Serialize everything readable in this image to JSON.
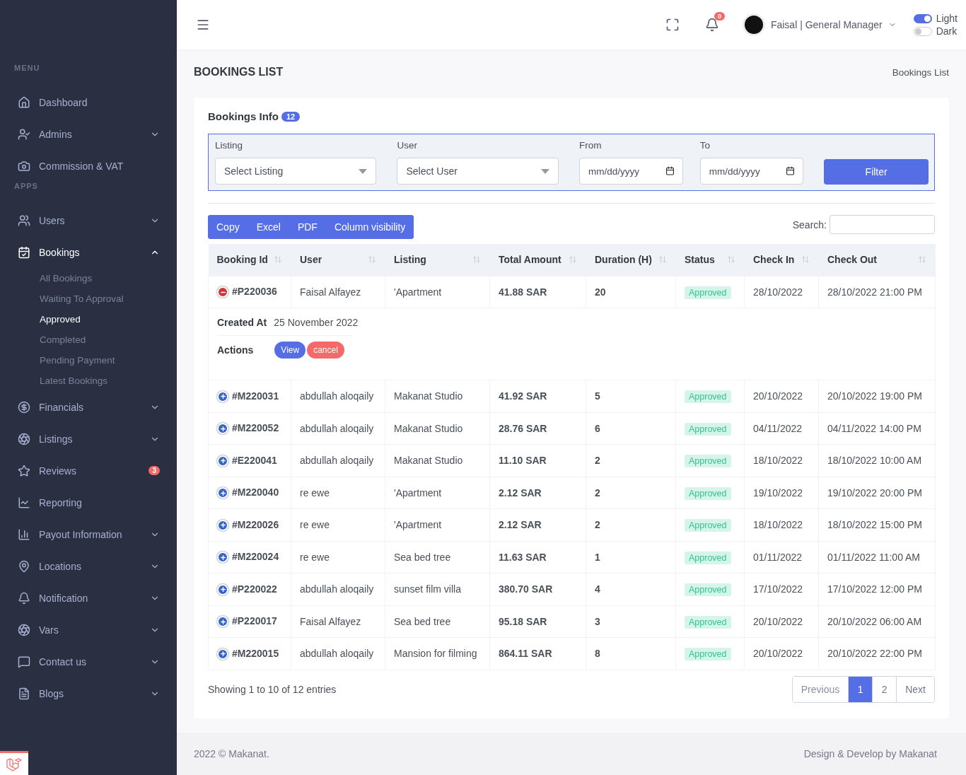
{
  "sidebar": {
    "sections": [
      {
        "title": "MENU",
        "items": [
          {
            "label": "Dashboard",
            "selected": false
          },
          {
            "label": "Admins",
            "selected": false,
            "expanded": false
          },
          {
            "label": "Commission & VAT",
            "selected": false
          }
        ]
      },
      {
        "title": "APPS",
        "items": [
          {
            "label": "Users",
            "selected": false,
            "expanded": false
          },
          {
            "label": "Bookings",
            "selected": true,
            "expanded": true,
            "children": [
              {
                "label": "All Bookings",
                "selected": false
              },
              {
                "label": "Waiting To Approval",
                "selected": false
              },
              {
                "label": "Approved",
                "selected": true
              },
              {
                "label": "Completed",
                "selected": false
              },
              {
                "label": "Pending Payment",
                "selected": false
              },
              {
                "label": "Latest Bookings",
                "selected": false
              }
            ]
          },
          {
            "label": "Financials",
            "selected": false,
            "expanded": false
          },
          {
            "label": "Listings",
            "selected": false,
            "expanded": false
          },
          {
            "label": "Reviews",
            "selected": false,
            "badge": "3"
          },
          {
            "label": "Reporting",
            "selected": false
          },
          {
            "label": "Payout Information",
            "selected": false,
            "expanded": false
          },
          {
            "label": "Locations",
            "selected": false,
            "expanded": false
          },
          {
            "label": "Notification",
            "selected": false,
            "expanded": false
          },
          {
            "label": "Vars",
            "selected": false,
            "expanded": false
          },
          {
            "label": "Contact us",
            "selected": false,
            "expanded": false
          },
          {
            "label": "Blogs",
            "selected": false,
            "expanded": false
          }
        ]
      }
    ]
  },
  "topbar": {
    "notification_count": "0",
    "user": "Faisal | General Manager",
    "themes": [
      {
        "label": "Light",
        "on": true
      },
      {
        "label": "Dark",
        "on": false
      }
    ]
  },
  "page": {
    "title": "BOOKINGS LIST",
    "breadcrumb": "Bookings List"
  },
  "card": {
    "title": "Bookings Info",
    "count": "12",
    "filters": {
      "listing": {
        "label": "Listing",
        "value": "Select Listing"
      },
      "user": {
        "label": "User",
        "value": "Select User"
      },
      "from": {
        "label": "From",
        "placeholder": "mm/dd/yyyy"
      },
      "to": {
        "label": "To",
        "placeholder": "mm/dd/yyyy"
      },
      "button": "Filter"
    },
    "export_buttons": [
      "Copy",
      "Excel",
      "PDF",
      "Column visibility"
    ],
    "search_label": "Search:",
    "table": {
      "columns": [
        "Booking Id",
        "User",
        "Listing",
        "Total Amount",
        "Duration (H)",
        "Status",
        "Check In",
        "Check Out"
      ],
      "rows": [
        {
          "expanded": true,
          "cells": [
            "#P220036",
            "Faisal Alfayez",
            "'Apartment",
            "41.88 SAR",
            "20",
            "Approved",
            "28/10/2022",
            "28/10/2022 21:00 PM"
          ],
          "details": {
            "created_label": "Created At",
            "created_value": "25 November 2022",
            "actions_label": "Actions",
            "actions": [
              {
                "label": "View",
                "kind": "primary"
              },
              {
                "label": "cancel",
                "kind": "danger"
              }
            ]
          }
        },
        {
          "expanded": false,
          "cells": [
            "#M220031",
            "abdullah aloqaily",
            "Makanat Studio",
            "41.92 SAR",
            "5",
            "Approved",
            "20/10/2022",
            "20/10/2022 19:00 PM"
          ]
        },
        {
          "expanded": false,
          "cells": [
            "#M220052",
            "abdullah aloqaily",
            "Makanat Studio",
            "28.76 SAR",
            "6",
            "Approved",
            "04/11/2022",
            "04/11/2022 14:00 PM"
          ]
        },
        {
          "expanded": false,
          "cells": [
            "#E220041",
            "abdullah aloqaily",
            "Makanat Studio",
            "11.10 SAR",
            "2",
            "Approved",
            "18/10/2022",
            "18/10/2022 10:00 AM"
          ]
        },
        {
          "expanded": false,
          "cells": [
            "#M220040",
            "re ewe",
            "'Apartment",
            "2.12 SAR",
            "2",
            "Approved",
            "19/10/2022",
            "19/10/2022 20:00 PM"
          ]
        },
        {
          "expanded": false,
          "cells": [
            "#M220026",
            "re ewe",
            "'Apartment",
            "2.12 SAR",
            "2",
            "Approved",
            "18/10/2022",
            "18/10/2022 15:00 PM"
          ]
        },
        {
          "expanded": false,
          "cells": [
            "#M220024",
            "re ewe",
            "Sea bed tree",
            "11.63 SAR",
            "1",
            "Approved",
            "01/11/2022",
            "01/11/2022 11:00 AM"
          ]
        },
        {
          "expanded": false,
          "cells": [
            "#P220022",
            "abdullah aloqaily",
            "sunset film villa",
            "380.70 SAR",
            "4",
            "Approved",
            "17/10/2022",
            "17/10/2022 12:00 PM"
          ]
        },
        {
          "expanded": false,
          "cells": [
            "#P220017",
            "Faisal Alfayez",
            "Sea bed tree",
            "95.18 SAR",
            "3",
            "Approved",
            "20/10/2022",
            "20/10/2022 06:00 AM"
          ]
        },
        {
          "expanded": false,
          "cells": [
            "#M220015",
            "abdullah aloqaily",
            "Mansion for filming",
            "864.11 SAR",
            "8",
            "Approved",
            "20/10/2022",
            "20/10/2022 22:00 PM"
          ]
        }
      ]
    },
    "info": "Showing 1 to 10 of 12 entries",
    "pagination": [
      {
        "label": "Previous",
        "kind": "nav",
        "disabled": true,
        "selected": false
      },
      {
        "label": "1",
        "kind": "page",
        "disabled": false,
        "selected": true
      },
      {
        "label": "2",
        "kind": "page",
        "disabled": false,
        "selected": false
      },
      {
        "label": "Next",
        "kind": "nav",
        "disabled": false,
        "selected": false
      }
    ]
  },
  "footer": {
    "left": "2022 © Makanat.",
    "right": "Design & Develop by Makanat"
  }
}
